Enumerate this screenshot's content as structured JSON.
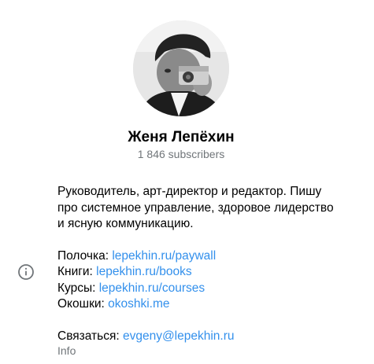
{
  "channel": {
    "name": "Женя Лепёхин",
    "subscribers": "1 846 subscribers"
  },
  "about": {
    "description_lines": [
      "Руководитель, арт-директор и редактор. Пишу",
      "про системное управление, здоровое лидерство",
      "и ясную коммуникацию."
    ],
    "links": [
      {
        "label": "Полочка: ",
        "url": "lepekhin.ru/paywall"
      },
      {
        "label": "Книги: ",
        "url": "lepekhin.ru/books"
      },
      {
        "label": "Курсы: ",
        "url": "lepekhin.ru/courses"
      },
      {
        "label": "Окошки: ",
        "url": "okoshki.me"
      }
    ],
    "contact": {
      "label": "Связаться: ",
      "email": "evgeny@lepekhin.ru"
    },
    "caption": "Info"
  },
  "colors": {
    "link": "#3390ec",
    "secondary_text": "#707579"
  },
  "icons": {
    "info": "info-circle-icon"
  }
}
